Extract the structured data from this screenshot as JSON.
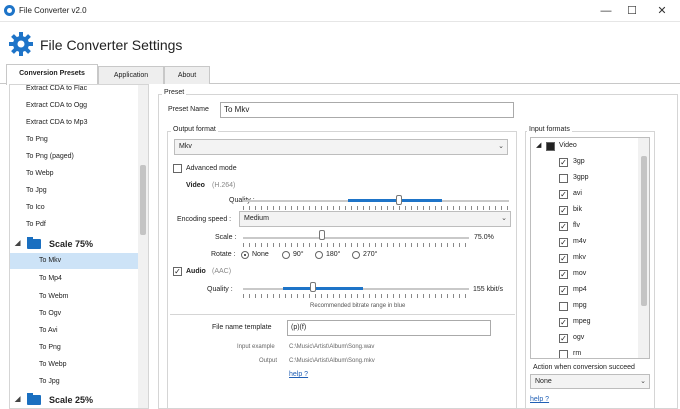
{
  "window": {
    "title": "File Converter v2.0"
  },
  "header": {
    "title": "File Converter Settings"
  },
  "tabs": [
    {
      "label": "Conversion Presets",
      "active": true
    },
    {
      "label": "Application",
      "active": false
    },
    {
      "label": "About",
      "active": false
    }
  ],
  "tree": {
    "items": [
      {
        "label": "Extract CDA to Flac",
        "kind": "item"
      },
      {
        "label": "Extract CDA to Ogg",
        "kind": "item"
      },
      {
        "label": "Extract CDA to Mp3",
        "kind": "item"
      },
      {
        "label": "To Png",
        "kind": "item"
      },
      {
        "label": "To Png (paged)",
        "kind": "item"
      },
      {
        "label": "To Webp",
        "kind": "item"
      },
      {
        "label": "To Jpg",
        "kind": "item"
      },
      {
        "label": "To Ico",
        "kind": "item"
      },
      {
        "label": "To Pdf",
        "kind": "item"
      },
      {
        "label": "Scale 75%",
        "kind": "group"
      },
      {
        "label": "To Mkv",
        "kind": "child",
        "selected": true
      },
      {
        "label": "To Mp4",
        "kind": "child"
      },
      {
        "label": "To Webm",
        "kind": "child"
      },
      {
        "label": "To Ogv",
        "kind": "child"
      },
      {
        "label": "To Avi",
        "kind": "child"
      },
      {
        "label": "To Png",
        "kind": "child"
      },
      {
        "label": "To Webp",
        "kind": "child"
      },
      {
        "label": "To Jpg",
        "kind": "child"
      },
      {
        "label": "Scale 25%",
        "kind": "group"
      }
    ]
  },
  "preset": {
    "group_label": "Preset",
    "name_label": "Preset Name",
    "name_value": "To Mkv"
  },
  "output": {
    "group_label": "Output format",
    "format_value": "Mkv",
    "advanced_mode_label": "Advanced mode",
    "advanced_mode_checked": false,
    "video_label": "Video",
    "video_codec": "(H.264)",
    "quality_label": "Quality :",
    "video_quality_fraction": 0.68,
    "encoding_speed_label": "Encoding speed :",
    "encoding_speed_value": "Medium",
    "scale_label": "Scale :",
    "scale_value": "75.0%",
    "scale_fraction": 0.35,
    "rotate_label": "Rotate :",
    "rotate_options": [
      "None",
      "90°",
      "180°",
      "270°"
    ],
    "rotate_selected": 0,
    "audio_label": "Audio",
    "audio_checked": true,
    "audio_codec": "(AAC)",
    "audio_quality_label": "Quality :",
    "audio_quality_value": "155 kbit/s",
    "audio_quality_fraction": 0.32,
    "recommended_note": "Recommended bitrate range in blue",
    "filename_template_label": "File name template",
    "filename_template_value": "(p)(f)",
    "input_example_label": "Input example",
    "input_example_value": "C:\\Music\\Artist\\Album\\Song.wav",
    "output_label": "Output",
    "output_value": "C:\\Music\\Artist\\Album\\Song.mkv",
    "help_label": "help ?"
  },
  "input_formats": {
    "group_label": "Input formats",
    "category": "Video",
    "items": [
      {
        "label": "3gp",
        "checked": true
      },
      {
        "label": "3gpp",
        "checked": false
      },
      {
        "label": "avi",
        "checked": true
      },
      {
        "label": "bik",
        "checked": true
      },
      {
        "label": "flv",
        "checked": true
      },
      {
        "label": "m4v",
        "checked": true
      },
      {
        "label": "mkv",
        "checked": true
      },
      {
        "label": "mov",
        "checked": true
      },
      {
        "label": "mp4",
        "checked": true
      },
      {
        "label": "mpg",
        "checked": false
      },
      {
        "label": "mpeg",
        "checked": true
      },
      {
        "label": "ogv",
        "checked": true
      },
      {
        "label": "rm",
        "checked": false
      }
    ]
  },
  "action": {
    "label": "Action when conversion succeed",
    "value": "None",
    "help_label": "help ?"
  },
  "colors": {
    "accent": "#1e74c8",
    "selection": "#cde3f7"
  }
}
